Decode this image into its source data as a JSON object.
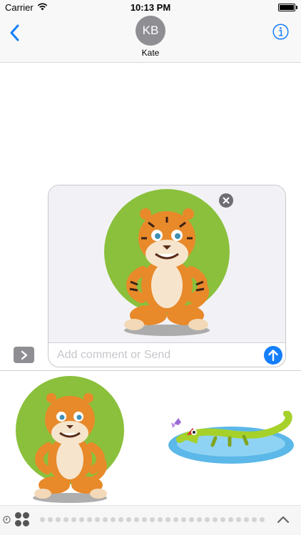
{
  "status_bar": {
    "carrier": "Carrier",
    "time": "10:13 PM",
    "icons": [
      "wifi-icon",
      "battery-icon"
    ]
  },
  "header": {
    "avatar_initials": "KB",
    "contact_name": "Kate",
    "icons": [
      "chevron-left-icon",
      "info-icon"
    ]
  },
  "compose": {
    "placeholder": "Add comment or Send",
    "value": "",
    "attached_sticker": "tiger-sticker",
    "icons": [
      "remove-icon",
      "send-arrow-icon",
      "expand-chevron-icon"
    ]
  },
  "drawer": {
    "stickers": [
      "tiger-sticker",
      "crocodile-sticker"
    ]
  },
  "app_strip": {
    "icons": [
      "recents-icon",
      "apps-grid-icon",
      "collapse-chevron-icon"
    ]
  },
  "colors": {
    "accent_blue": "#147efb",
    "sticker_green": "#8bc03c",
    "avatar_gray": "#8e8e93"
  }
}
